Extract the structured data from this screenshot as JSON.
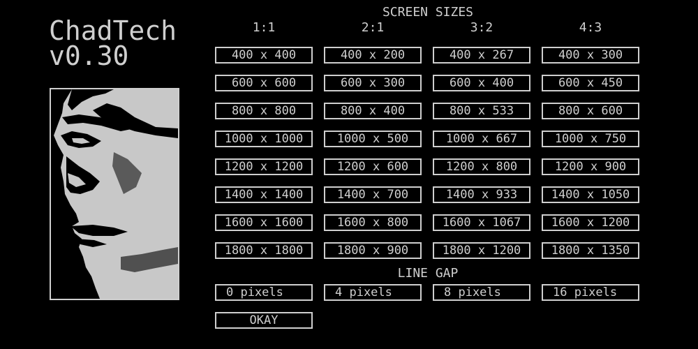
{
  "app": {
    "title_line1": "ChadTech",
    "title_line2": "v0.30"
  },
  "portrait": {
    "description_icon": "face-portrait-image"
  },
  "colors": {
    "background": "#000000",
    "foreground": "#cfcfcf"
  },
  "screen_sizes": {
    "heading": "SCREEN SIZES",
    "ratios": [
      "1:1",
      "2:1",
      "3:2",
      "4:3"
    ],
    "rows": [
      [
        "400 x 400",
        "400 x 200",
        "400 x 267",
        "400 x 300"
      ],
      [
        "600 x 600",
        "600 x 300",
        "600 x 400",
        "600 x 450"
      ],
      [
        "800 x 800",
        "800 x 400",
        "800 x 533",
        "800 x 600"
      ],
      [
        "1000 x 1000",
        "1000 x 500",
        "1000 x 667",
        "1000 x 750"
      ],
      [
        "1200 x 1200",
        "1200 x 600",
        "1200 x 800",
        "1200 x 900"
      ],
      [
        "1400 x 1400",
        "1400 x 700",
        "1400 x 933",
        "1400 x 1050"
      ],
      [
        "1600 x 1600",
        "1600 x 800",
        "1600 x 1067",
        "1600 x 1200"
      ],
      [
        "1800 x 1800",
        "1800 x 900",
        "1800 x 1200",
        "1800 x 1350"
      ]
    ]
  },
  "line_gap": {
    "heading": "LINE GAP",
    "options": [
      "0 pixels",
      "4 pixels",
      "8 pixels",
      "16 pixels"
    ]
  },
  "okay_label": "OKAY"
}
